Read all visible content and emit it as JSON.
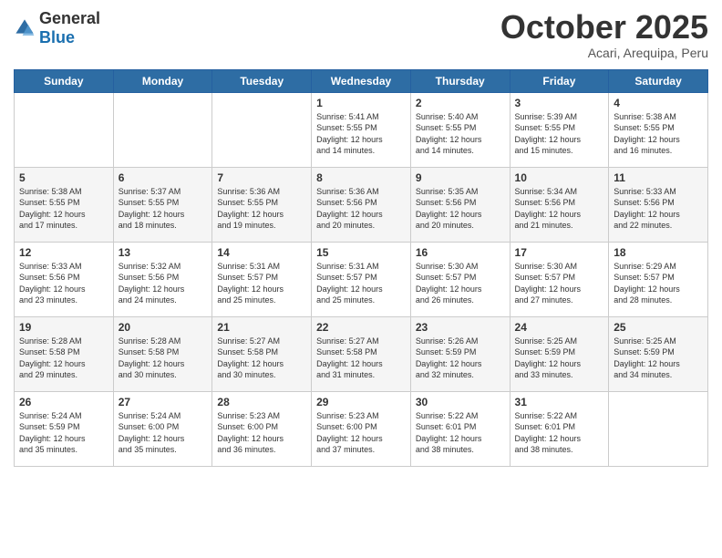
{
  "header": {
    "logo_general": "General",
    "logo_blue": "Blue",
    "month": "October 2025",
    "location": "Acari, Arequipa, Peru"
  },
  "weekdays": [
    "Sunday",
    "Monday",
    "Tuesday",
    "Wednesday",
    "Thursday",
    "Friday",
    "Saturday"
  ],
  "weeks": [
    [
      {
        "day": "",
        "info": ""
      },
      {
        "day": "",
        "info": ""
      },
      {
        "day": "",
        "info": ""
      },
      {
        "day": "1",
        "info": "Sunrise: 5:41 AM\nSunset: 5:55 PM\nDaylight: 12 hours\nand 14 minutes."
      },
      {
        "day": "2",
        "info": "Sunrise: 5:40 AM\nSunset: 5:55 PM\nDaylight: 12 hours\nand 14 minutes."
      },
      {
        "day": "3",
        "info": "Sunrise: 5:39 AM\nSunset: 5:55 PM\nDaylight: 12 hours\nand 15 minutes."
      },
      {
        "day": "4",
        "info": "Sunrise: 5:38 AM\nSunset: 5:55 PM\nDaylight: 12 hours\nand 16 minutes."
      }
    ],
    [
      {
        "day": "5",
        "info": "Sunrise: 5:38 AM\nSunset: 5:55 PM\nDaylight: 12 hours\nand 17 minutes."
      },
      {
        "day": "6",
        "info": "Sunrise: 5:37 AM\nSunset: 5:55 PM\nDaylight: 12 hours\nand 18 minutes."
      },
      {
        "day": "7",
        "info": "Sunrise: 5:36 AM\nSunset: 5:55 PM\nDaylight: 12 hours\nand 19 minutes."
      },
      {
        "day": "8",
        "info": "Sunrise: 5:36 AM\nSunset: 5:56 PM\nDaylight: 12 hours\nand 20 minutes."
      },
      {
        "day": "9",
        "info": "Sunrise: 5:35 AM\nSunset: 5:56 PM\nDaylight: 12 hours\nand 20 minutes."
      },
      {
        "day": "10",
        "info": "Sunrise: 5:34 AM\nSunset: 5:56 PM\nDaylight: 12 hours\nand 21 minutes."
      },
      {
        "day": "11",
        "info": "Sunrise: 5:33 AM\nSunset: 5:56 PM\nDaylight: 12 hours\nand 22 minutes."
      }
    ],
    [
      {
        "day": "12",
        "info": "Sunrise: 5:33 AM\nSunset: 5:56 PM\nDaylight: 12 hours\nand 23 minutes."
      },
      {
        "day": "13",
        "info": "Sunrise: 5:32 AM\nSunset: 5:56 PM\nDaylight: 12 hours\nand 24 minutes."
      },
      {
        "day": "14",
        "info": "Sunrise: 5:31 AM\nSunset: 5:57 PM\nDaylight: 12 hours\nand 25 minutes."
      },
      {
        "day": "15",
        "info": "Sunrise: 5:31 AM\nSunset: 5:57 PM\nDaylight: 12 hours\nand 25 minutes."
      },
      {
        "day": "16",
        "info": "Sunrise: 5:30 AM\nSunset: 5:57 PM\nDaylight: 12 hours\nand 26 minutes."
      },
      {
        "day": "17",
        "info": "Sunrise: 5:30 AM\nSunset: 5:57 PM\nDaylight: 12 hours\nand 27 minutes."
      },
      {
        "day": "18",
        "info": "Sunrise: 5:29 AM\nSunset: 5:57 PM\nDaylight: 12 hours\nand 28 minutes."
      }
    ],
    [
      {
        "day": "19",
        "info": "Sunrise: 5:28 AM\nSunset: 5:58 PM\nDaylight: 12 hours\nand 29 minutes."
      },
      {
        "day": "20",
        "info": "Sunrise: 5:28 AM\nSunset: 5:58 PM\nDaylight: 12 hours\nand 30 minutes."
      },
      {
        "day": "21",
        "info": "Sunrise: 5:27 AM\nSunset: 5:58 PM\nDaylight: 12 hours\nand 30 minutes."
      },
      {
        "day": "22",
        "info": "Sunrise: 5:27 AM\nSunset: 5:58 PM\nDaylight: 12 hours\nand 31 minutes."
      },
      {
        "day": "23",
        "info": "Sunrise: 5:26 AM\nSunset: 5:59 PM\nDaylight: 12 hours\nand 32 minutes."
      },
      {
        "day": "24",
        "info": "Sunrise: 5:25 AM\nSunset: 5:59 PM\nDaylight: 12 hours\nand 33 minutes."
      },
      {
        "day": "25",
        "info": "Sunrise: 5:25 AM\nSunset: 5:59 PM\nDaylight: 12 hours\nand 34 minutes."
      }
    ],
    [
      {
        "day": "26",
        "info": "Sunrise: 5:24 AM\nSunset: 5:59 PM\nDaylight: 12 hours\nand 35 minutes."
      },
      {
        "day": "27",
        "info": "Sunrise: 5:24 AM\nSunset: 6:00 PM\nDaylight: 12 hours\nand 35 minutes."
      },
      {
        "day": "28",
        "info": "Sunrise: 5:23 AM\nSunset: 6:00 PM\nDaylight: 12 hours\nand 36 minutes."
      },
      {
        "day": "29",
        "info": "Sunrise: 5:23 AM\nSunset: 6:00 PM\nDaylight: 12 hours\nand 37 minutes."
      },
      {
        "day": "30",
        "info": "Sunrise: 5:22 AM\nSunset: 6:01 PM\nDaylight: 12 hours\nand 38 minutes."
      },
      {
        "day": "31",
        "info": "Sunrise: 5:22 AM\nSunset: 6:01 PM\nDaylight: 12 hours\nand 38 minutes."
      },
      {
        "day": "",
        "info": ""
      }
    ]
  ]
}
